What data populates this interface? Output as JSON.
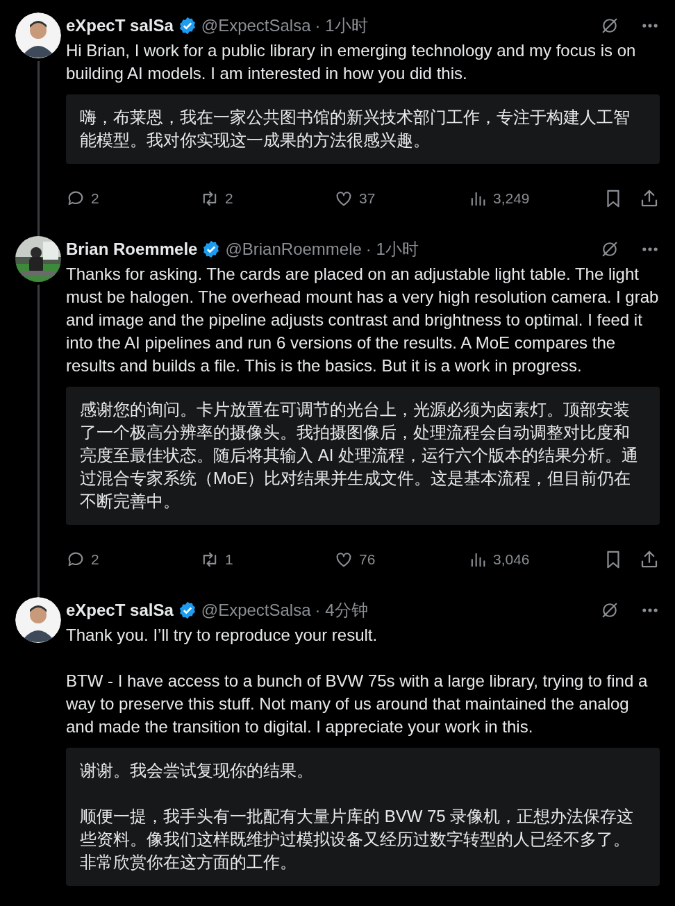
{
  "tweets": [
    {
      "avatar": {
        "kind": "figure"
      },
      "name": "eXpecT salSa",
      "verified": true,
      "handle": "@ExpectSalsa",
      "time": "· 1小时",
      "text": [
        "Hi Brian,  I work for a public library in emerging technology and my focus is on building AI models.  I am interested in how you did this."
      ],
      "translation": [
        "嗨，布莱恩，我在一家公共图书馆的新兴技术部门工作，专注于构建人工智能模型。我对你实现这一成果的方法很感兴趣。"
      ],
      "actions": {
        "replies": "2",
        "reposts": "2",
        "likes": "37",
        "views": "3,249"
      }
    },
    {
      "avatar": {
        "kind": "picture"
      },
      "name": "Brian Roemmele",
      "verified": true,
      "handle": "@BrianRoemmele",
      "time": "· 1小时",
      "text": [
        "Thanks for asking. The cards are placed on an adjustable light table. The light must be halogen. The overhead mount has a very high resolution camera. I grab and image and the pipeline adjusts contrast and brightness to optimal. I feed it into the AI pipelines and run 6 versions of the results. A MoE compares the results and builds a file. This is the basics. But it is a work in progress."
      ],
      "translation": [
        "感谢您的询问。卡片放置在可调节的光台上，光源必须为卤素灯。顶部安装了一个极高分辨率的摄像头。我拍摄图像后，处理流程会自动调整对比度和亮度至最佳状态。随后将其输入 AI 处理流程，运行六个版本的结果分析。通过混合专家系统（MoE）比对结果并生成文件。这是基本流程，但目前仍在不断完善中。"
      ],
      "actions": {
        "replies": "2",
        "reposts": "1",
        "likes": "76",
        "views": "3,046"
      }
    },
    {
      "avatar": {
        "kind": "figure"
      },
      "name": "eXpecT salSa",
      "verified": true,
      "handle": "@ExpectSalsa",
      "time": "· 4分钟",
      "text": [
        "Thank you.   I’ll try to reproduce your result.",
        "BTW - I have access to a bunch of BVW 75s with a large library,  trying to find a way to preserve this stuff.  Not many of us around that maintained the analog and made the transition to digital.  I appreciate your work in this."
      ],
      "translation": [
        "谢谢。我会尝试复现你的结果。",
        "顺便一提，我手头有一批配有大量片库的 BVW 75 录像机，正想办法保存这些资料。像我们这样既维护过模拟设备又经历过数字转型的人已经不多了。非常欣赏你在这方面的工作。"
      ]
    }
  ]
}
